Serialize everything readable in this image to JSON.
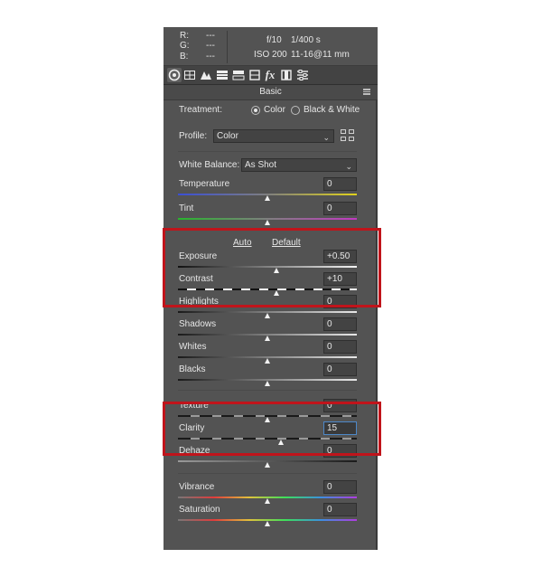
{
  "info": {
    "r_label": "R:",
    "g_label": "G:",
    "b_label": "B:",
    "r_value": "---",
    "g_value": "---",
    "b_value": "---",
    "aperture": "f/10",
    "shutter": "1/400 s",
    "iso": "ISO 200",
    "lens": "11-16@11 mm"
  },
  "toolbar": {
    "icons": [
      "aperture-icon",
      "tone-curve-icon",
      "detail-icon",
      "hsl-icon",
      "split-toning-icon",
      "lens-icon",
      "effects-icon",
      "calibration-icon",
      "presets-icon"
    ],
    "effects_glyph": "fx"
  },
  "panel": {
    "title": "Basic",
    "treatment_label": "Treatment:",
    "treatment_options": [
      "Color",
      "Black & White"
    ],
    "treatment_selected": "Color",
    "profile_label": "Profile:",
    "profile_value": "Color",
    "wb_label": "White Balance:",
    "wb_value": "As Shot",
    "auto_label": "Auto",
    "default_label": "Default"
  },
  "sliders": [
    {
      "name": "Temperature",
      "value": "0",
      "position": 0.5
    },
    {
      "name": "Tint",
      "value": "0",
      "position": 0.5
    },
    {
      "name": "Exposure",
      "value": "+0.50",
      "position": 0.55
    },
    {
      "name": "Contrast",
      "value": "+10",
      "position": 0.55
    },
    {
      "name": "Highlights",
      "value": "0",
      "position": 0.5
    },
    {
      "name": "Shadows",
      "value": "0",
      "position": 0.5
    },
    {
      "name": "Whites",
      "value": "0",
      "position": 0.5
    },
    {
      "name": "Blacks",
      "value": "0",
      "position": 0.5
    },
    {
      "name": "Texture",
      "value": "0",
      "position": 0.5
    },
    {
      "name": "Clarity",
      "value": "15",
      "position": 0.575
    },
    {
      "name": "Dehaze",
      "value": "0",
      "position": 0.5
    },
    {
      "name": "Vibrance",
      "value": "0",
      "position": 0.5
    },
    {
      "name": "Saturation",
      "value": "0",
      "position": 0.5
    }
  ],
  "colors": {
    "panel_bg": "#535353",
    "highlight_box": "#c0141b",
    "focus_border": "#4d88c8"
  }
}
